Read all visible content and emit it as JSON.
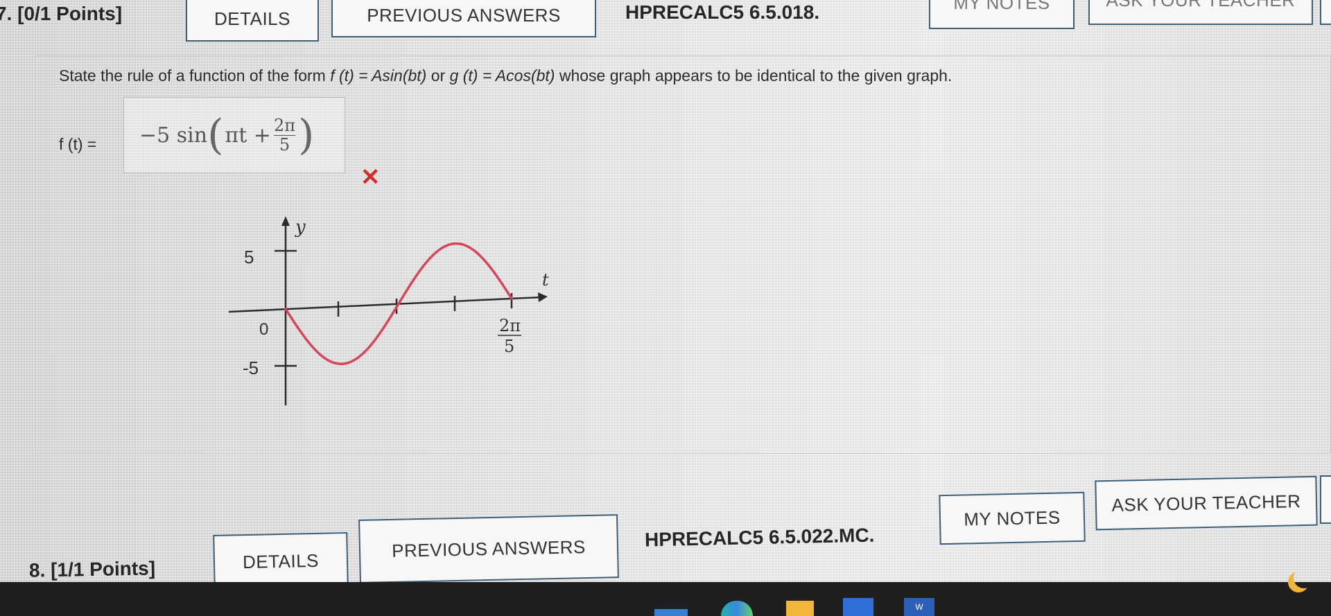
{
  "q7": {
    "number": "7.",
    "points": "[0/1 Points]",
    "details_label": "DETAILS",
    "previous_label": "PREVIOUS ANSWERS",
    "code": "HPRECALC5 6.5.018.",
    "notes_label": "MY NOTES",
    "ask_label": "ASK YOUR TEACHER",
    "prompt": {
      "before": "State the rule of a function of the form ",
      "f_form": "f (t) = Asin(bt)",
      "or": " or ",
      "g_form": "g (t) = Acos(bt)",
      "after": " whose graph appears to be identical to the given graph."
    },
    "answer_label": "f (t) =",
    "answer": {
      "lead": "−5 sin",
      "inner": "πt +",
      "numerator": "2π",
      "denominator": "5"
    },
    "result_icon": "incorrect-x-icon",
    "graph": {
      "y_axis_label": "y",
      "x_axis_label": "t",
      "y_top_tick": "5",
      "y_bottom_tick": "-5",
      "origin_label": "0",
      "x_tick_numerator": "2π",
      "x_tick_denominator": "5",
      "curve_color": "#d6455a",
      "curve": {
        "function": "y = -5 sin(5πt/4)",
        "points": [
          [
            0,
            0
          ],
          [
            0.4,
            -5
          ],
          [
            0.8,
            0
          ],
          [
            1.2,
            5
          ],
          [
            1.6,
            0
          ]
        ]
      }
    }
  },
  "q8": {
    "number": "8.",
    "points": "[1/1 Points]",
    "details_label": "DETAILS",
    "previous_label": "PREVIOUS ANSWERS",
    "code": "HPRECALC5 6.5.022.MC.",
    "notes_label": "MY NOTES",
    "ask_label": "ASK YOUR TEACHER"
  },
  "colors": {
    "button_border": "#3a5f7a",
    "error_red": "#d42a2a",
    "taskbar": "#1f1f1f"
  }
}
